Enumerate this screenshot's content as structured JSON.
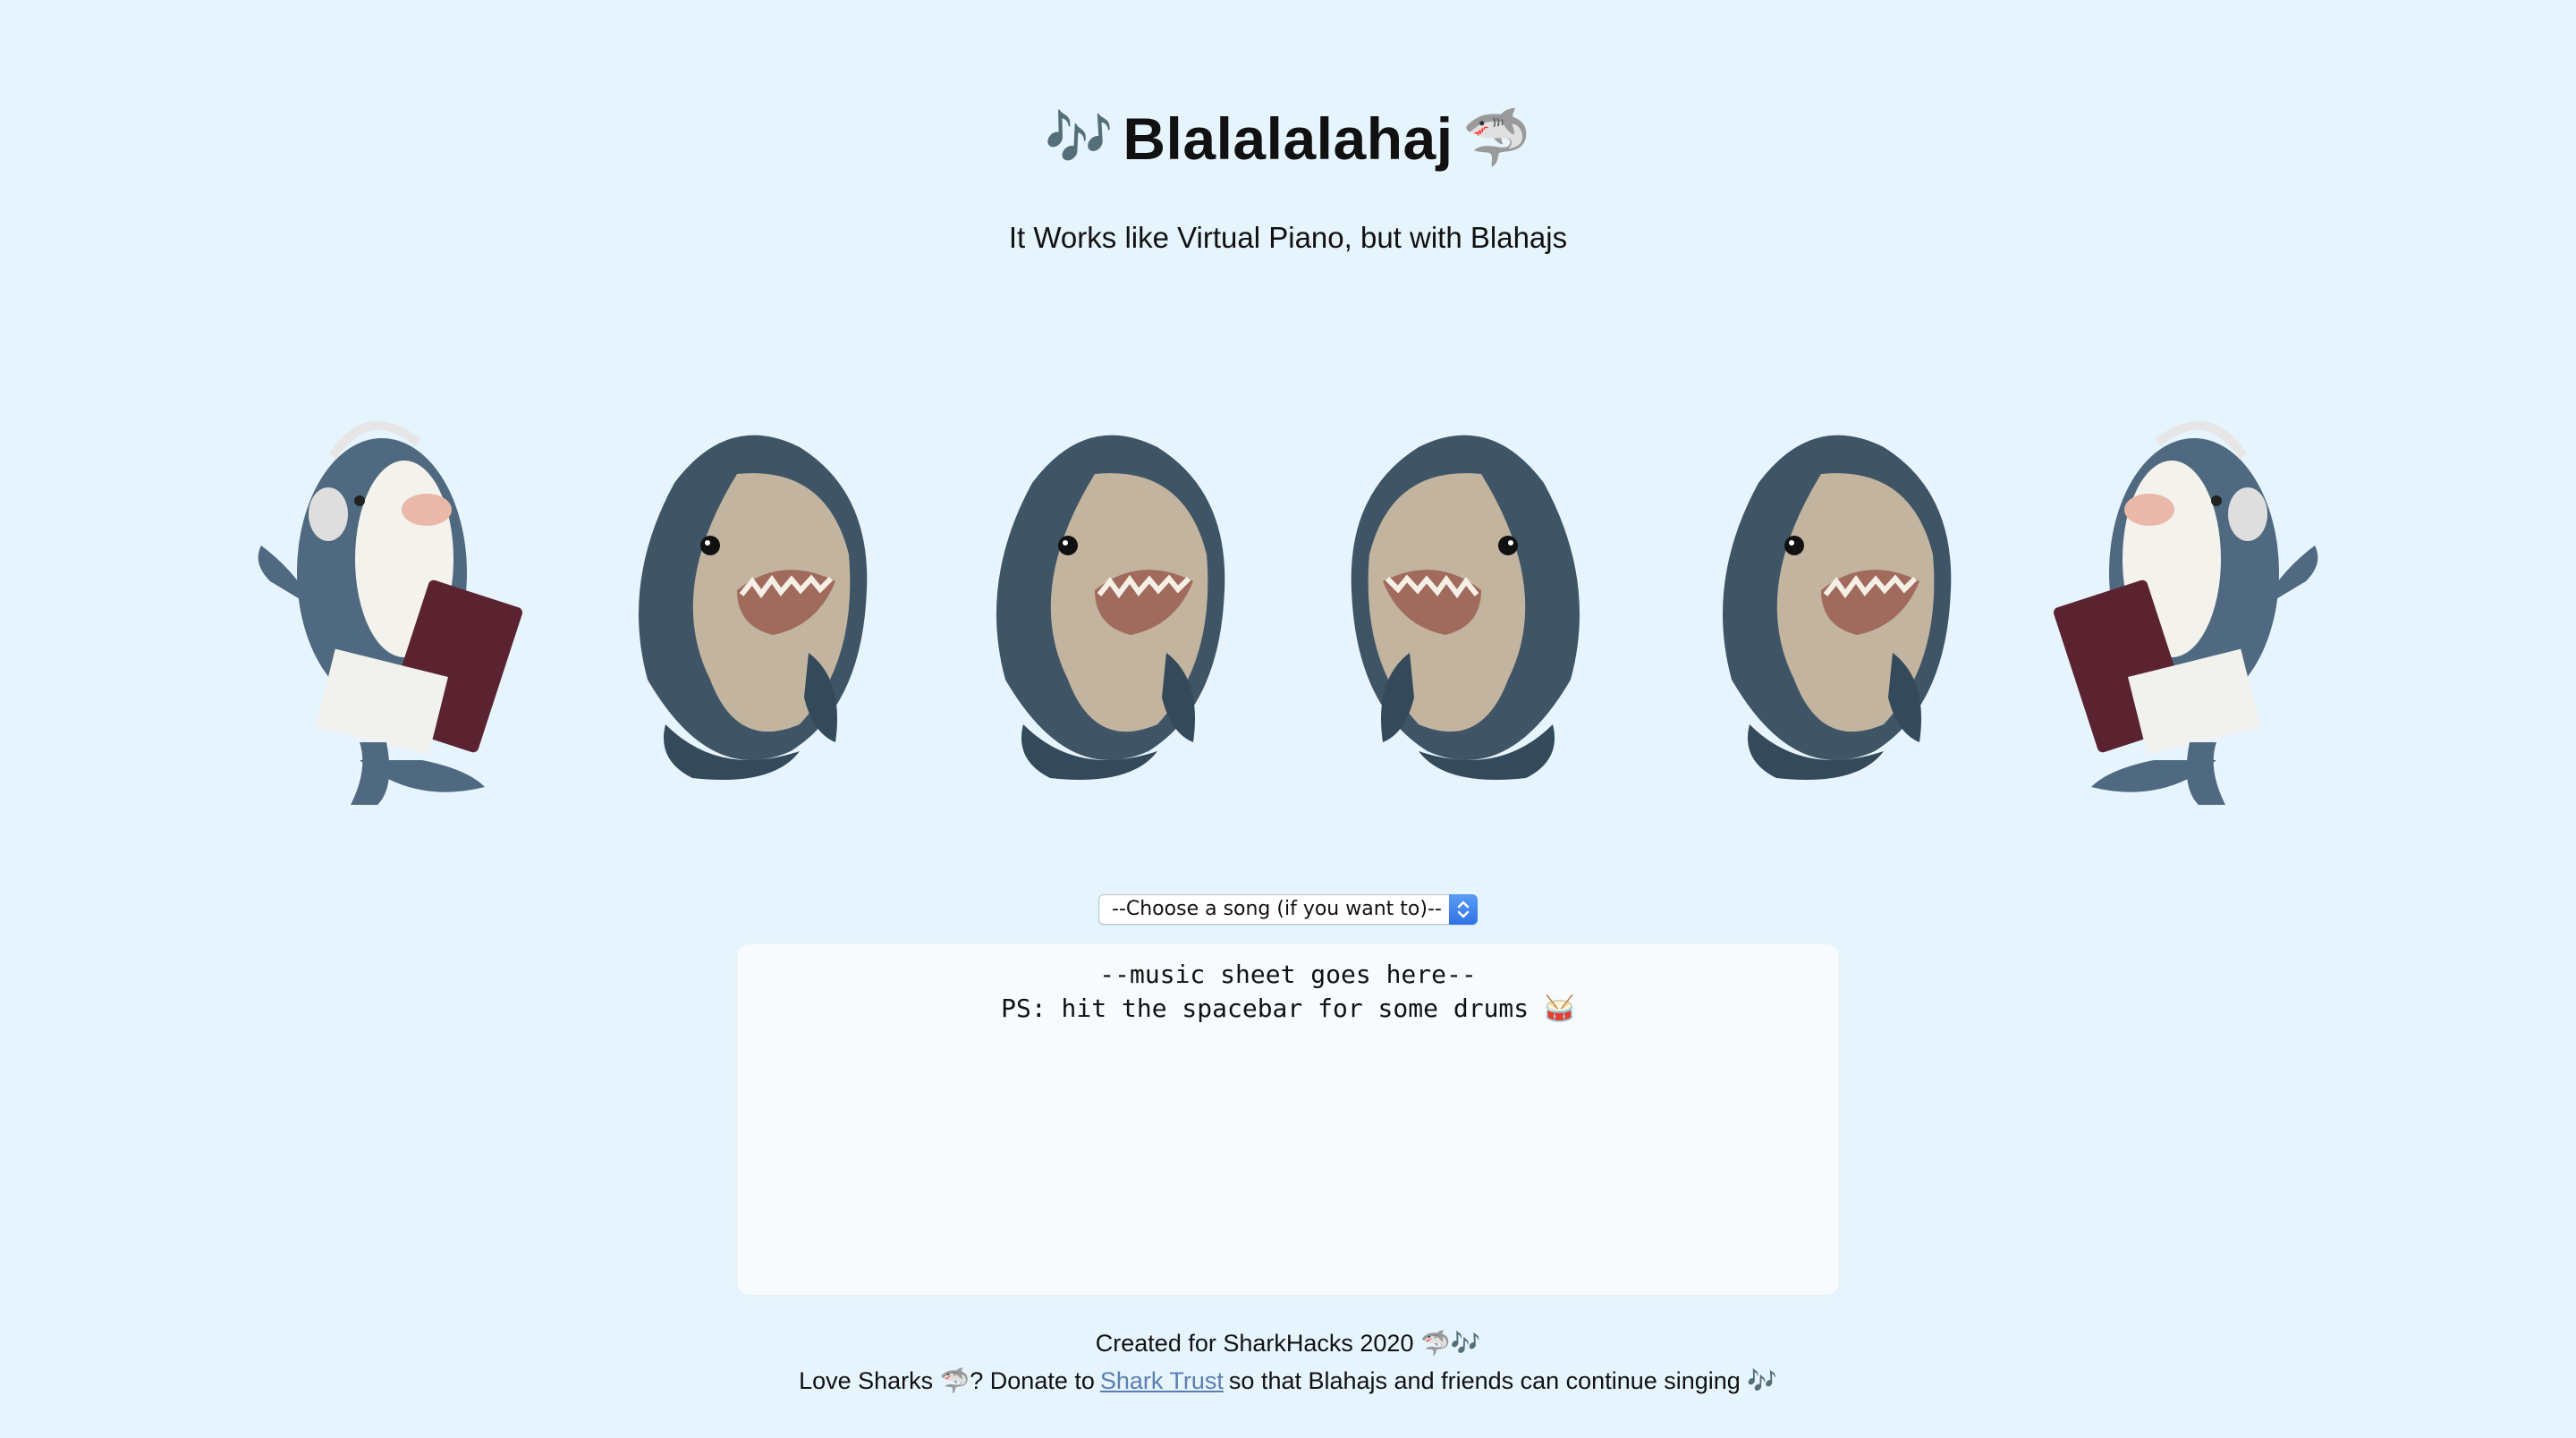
{
  "header": {
    "title": "Blalalalahaj",
    "title_emoji_left": "🎶",
    "title_emoji_right": "🦈",
    "subtitle": "It Works like Virtual Piano, but with Blahajs"
  },
  "sharks": [
    {
      "name": "headphone-shark-left",
      "icon": "shark-with-headphones-and-laptop"
    },
    {
      "name": "shark-key-2",
      "icon": "shark-plush-facing-left"
    },
    {
      "name": "shark-key-3",
      "icon": "shark-plush-facing-left"
    },
    {
      "name": "shark-key-4",
      "icon": "shark-plush-facing-right"
    },
    {
      "name": "shark-key-5",
      "icon": "shark-plush-facing-left"
    },
    {
      "name": "headphone-shark-right",
      "icon": "shark-with-headphones-and-laptop"
    }
  ],
  "song_select": {
    "selected": "--Choose a song (if you want to)--"
  },
  "music_sheet": {
    "line1": "--music sheet goes here--",
    "line2": "PS: hit the spacebar for some drums 🥁"
  },
  "footer": {
    "line1": "Created for SharkHacks 2020 🦈🎶",
    "line2_before": "Love Sharks 🦈? Donate to",
    "link_text": "Shark Trust",
    "line2_after": "so that Blahajs and friends can continue singing 🎶"
  },
  "colors": {
    "background": "#e6f4fd",
    "shark_body": "#3f5566",
    "shark_belly": "#c2b49f",
    "link": "#5c7fb3",
    "select_arrow": "#2f72e6"
  }
}
